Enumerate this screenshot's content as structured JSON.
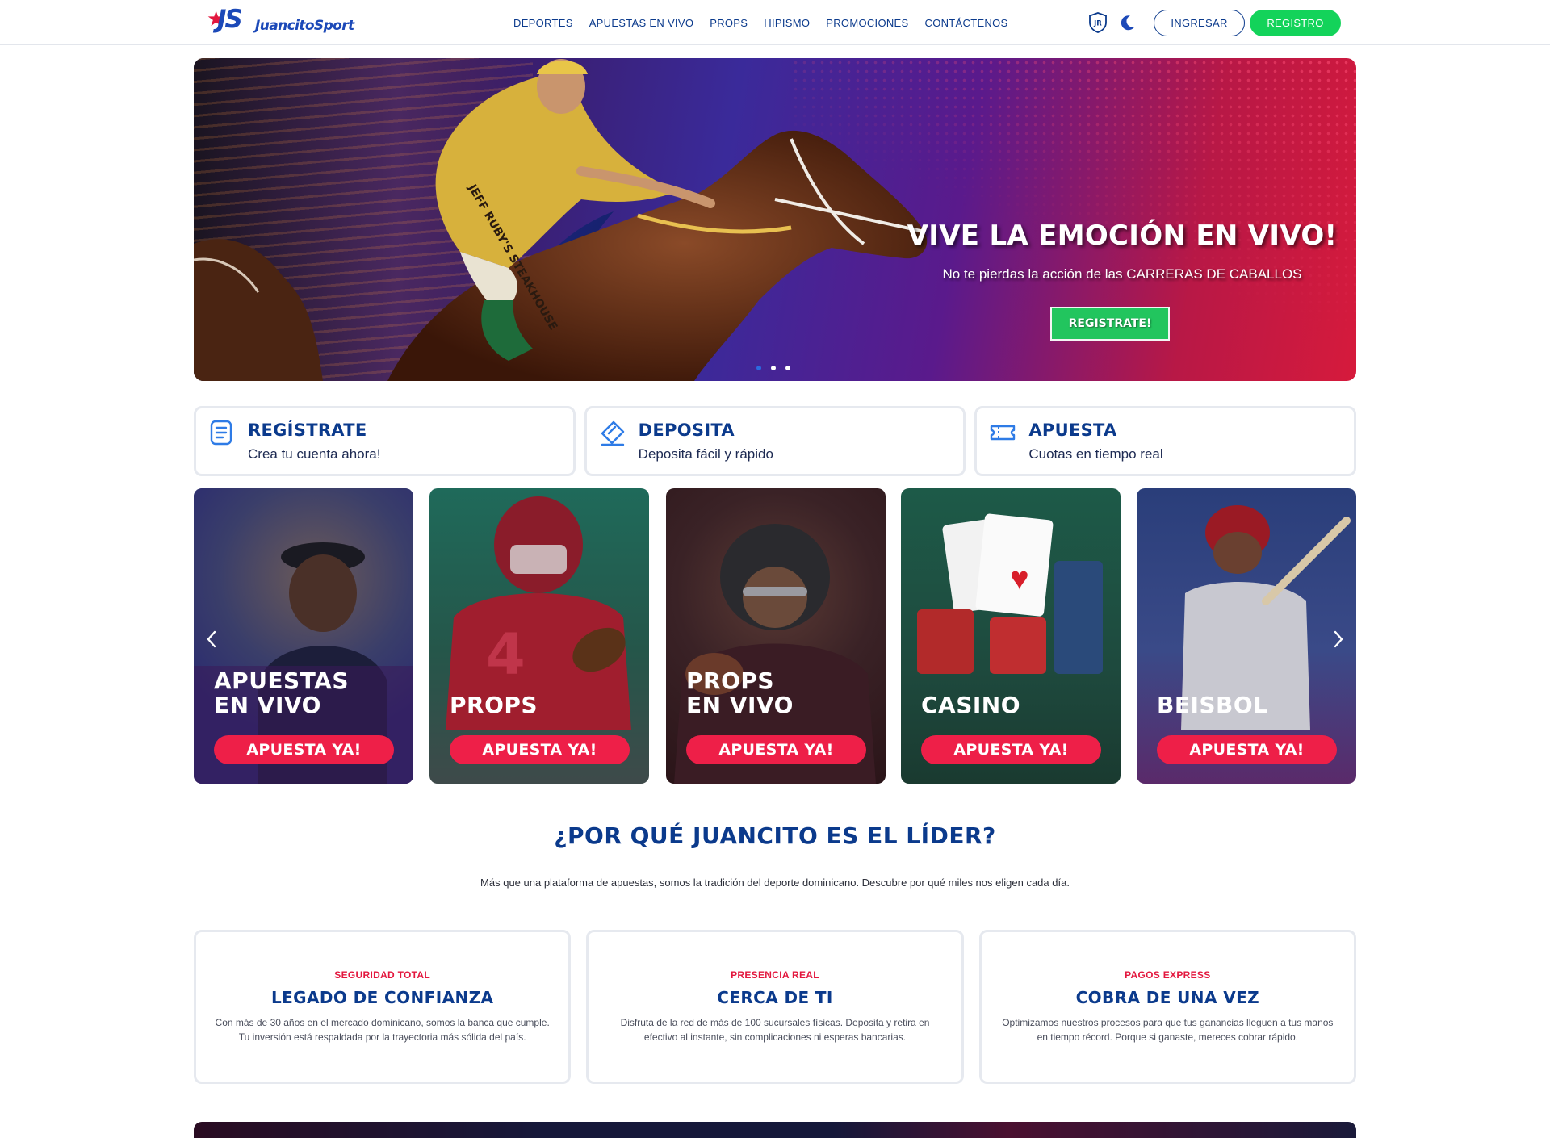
{
  "brand": {
    "mark": "JS",
    "name_a": "Juancito",
    "name_b": "Sport"
  },
  "nav": [
    {
      "label": "DEPORTES"
    },
    {
      "label": "APUESTAS EN VIVO"
    },
    {
      "label": "PROPS"
    },
    {
      "label": "HIPISMO"
    },
    {
      "label": "PROMOCIONES"
    },
    {
      "label": "CONTÁCTENOS"
    }
  ],
  "header": {
    "badge_text": "JR",
    "login_label": "INGRESAR",
    "register_label": "REGISTRO",
    "icons": [
      "shield-badge-icon",
      "moon-icon"
    ]
  },
  "hero": {
    "title": "VIVE LA EMOCIÓN EN VIVO!",
    "subtitle": "No te pierdas la acción de las CARRERAS DE CABALLOS",
    "cta": "REGISTRATE!",
    "slides": 3,
    "active_slide": 1,
    "jockey_text": "JEFF RUBY'S STEAKHOUSE"
  },
  "steps": [
    {
      "title": "REGÍSTRATE",
      "subtitle": "Crea tu cuenta ahora!",
      "icon": "form-icon"
    },
    {
      "title": "DEPOSITA",
      "subtitle": "Deposita fácil y rápido",
      "icon": "ticket-edit-icon"
    },
    {
      "title": "APUESTA",
      "subtitle": "Cuotas en tiempo real",
      "icon": "ticket-icon"
    }
  ],
  "categories": [
    {
      "title": "APUESTAS\nEN VIVO",
      "button": "APUESTA YA!"
    },
    {
      "title": "PROPS",
      "button": "APUESTA YA!"
    },
    {
      "title": "PROPS\nEN VIVO",
      "button": "APUESTA YA!"
    },
    {
      "title": "CASINO",
      "button": "APUESTA YA!"
    },
    {
      "title": "BEISBOL",
      "button": "APUESTA YA!"
    }
  ],
  "why": {
    "title": "¿POR QUÉ JUANCITO ES EL LÍDER?",
    "subtitle": "Más que una plataforma de apuestas, somos la tradición del deporte dominicano. Descubre por qué miles nos eligen cada día."
  },
  "features": [
    {
      "kicker": "SEGURIDAD TOTAL",
      "title": "LEGADO DE CONFIANZA",
      "description": "Con más de 30 años en el mercado dominicano, somos la banca que cumple. Tu inversión está respaldada por la trayectoria más sólida del país."
    },
    {
      "kicker": "PRESENCIA REAL",
      "title": "CERCA DE TI",
      "description": "Disfruta de la red de más de 100 sucursales físicas. Deposita y retira en efectivo al instante, sin complicaciones ni esperas bancarias."
    },
    {
      "kicker": "PAGOS EXPRESS",
      "title": "COBRA DE UNA VEZ",
      "description": "Optimizamos nuestros procesos para que tus ganancias lleguen a tus manos en tiempo récord. Porque si ganaste, mereces cobrar rápido."
    }
  ],
  "colors": {
    "brand_blue": "#0b3a8c",
    "accent_red": "#e3173e",
    "cta_green": "#13d35a",
    "card_button": "#ee1f48"
  }
}
